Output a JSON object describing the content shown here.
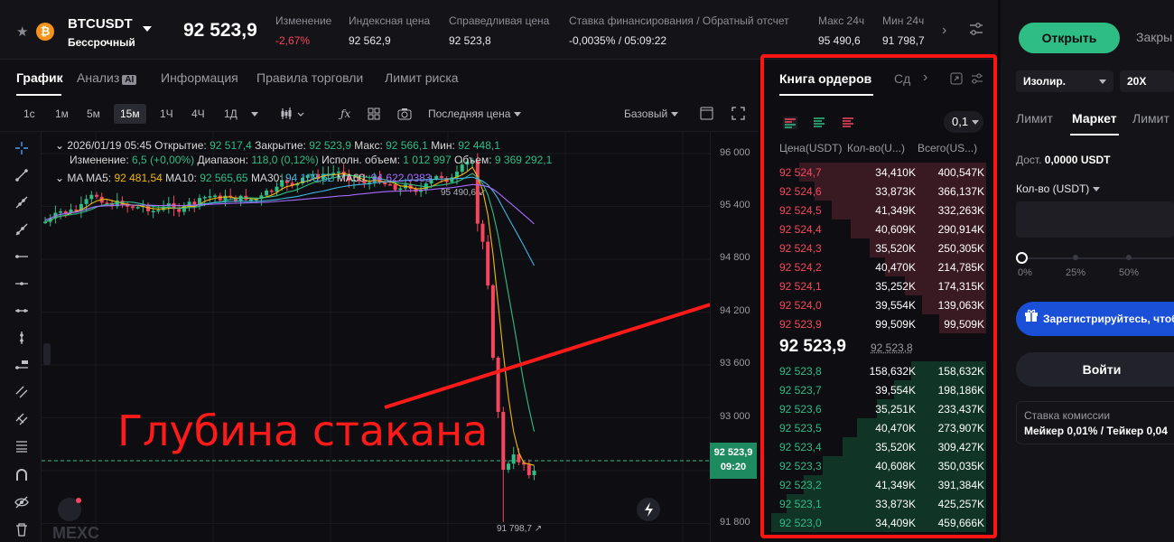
{
  "ticker": {
    "symbol": "BTCUSDT",
    "contract": "Бессрочный",
    "coin_letter": "₿",
    "last_price": "92 523,9",
    "stats": [
      {
        "label": "Изменение",
        "value": "-2,67%",
        "neg": true
      },
      {
        "label": "Индексная цена",
        "value": "92 562,9"
      },
      {
        "label": "Справедливая цена",
        "value": "92 523,8"
      },
      {
        "label": "Ставка финансирования / Обратный отсчет",
        "value": "-0,0035% / 05:09:22"
      },
      {
        "label": "Макс 24ч",
        "value": "95 490,6"
      },
      {
        "label": "Мин 24ч",
        "value": "91 798,7"
      }
    ]
  },
  "tabs": [
    "График",
    "Анализ",
    "Информация",
    "Правила торговли",
    "Лимит риска"
  ],
  "ai_badge": "AI",
  "intervals": [
    "1с",
    "1м",
    "5м",
    "15м",
    "1Ч",
    "4Ч",
    "1Д"
  ],
  "active_interval": "15м",
  "price_type": "Последняя цена",
  "view_mode": "Базовый",
  "overlay": {
    "date": "2026/01/19 05:45",
    "open_l": "Открытие:",
    "open": "92 517,4",
    "close_l": "Закрытие:",
    "close": "92 523,9",
    "max_l": "Макс:",
    "max": "92 566,1",
    "min_l": "Мин:",
    "min": "92 448,1",
    "chg_l": "Изменение:",
    "chg": "6,5 (+0,00%)",
    "rng_l": "Диапазон:",
    "rng": "118,0 (0,12%)",
    "vol_l": "Исполн. объем:",
    "vol": "1 012 997",
    "vol2_l": "Объем:",
    "vol2": "9 369 292,1",
    "ma_l": "MA",
    "ma5_l": "MA5:",
    "ma5": "92 481,54",
    "ma10_l": "MA10:",
    "ma10": "92 565,65",
    "ma30_l": "MA30:",
    "ma30": "94 108,62",
    "ma60_l": "MA60:",
    "ma60": "94 622,0383"
  },
  "y_axis": [
    "96 000",
    "95 400",
    "94 800",
    "94 200",
    "93 600",
    "93 000",
    "91 800"
  ],
  "chart_marks": {
    "high": "95 490,6",
    "low": "91 798,7"
  },
  "price_tag": {
    "price": "92 523,9",
    "timer": "09:20"
  },
  "annotation": "Глубина стакана",
  "watermark": "MEXC",
  "orderbook": {
    "title": "Книга ордеров",
    "tab2": "Сд",
    "step": "0,1",
    "headers": [
      "Цена(USDT)",
      "Кол-во(U...)",
      "Всего(US...)"
    ],
    "asks": [
      {
        "price": "92 524,7",
        "qty": "34,410K",
        "total": "400,547K",
        "depth": 0.87
      },
      {
        "price": "92 524,6",
        "qty": "33,873K",
        "total": "366,137K",
        "depth": 0.8
      },
      {
        "price": "92 524,5",
        "qty": "41,349K",
        "total": "332,263K",
        "depth": 0.72
      },
      {
        "price": "92 524,4",
        "qty": "40,609K",
        "total": "290,914K",
        "depth": 0.63
      },
      {
        "price": "92 524,3",
        "qty": "35,520K",
        "total": "250,305K",
        "depth": 0.54
      },
      {
        "price": "92 524,2",
        "qty": "40,470K",
        "total": "214,785K",
        "depth": 0.47
      },
      {
        "price": "92 524,1",
        "qty": "35,252K",
        "total": "174,315K",
        "depth": 0.38
      },
      {
        "price": "92 524,0",
        "qty": "39,554K",
        "total": "139,063K",
        "depth": 0.3
      },
      {
        "price": "92 523,9",
        "qty": "99,509K",
        "total": "99,509K",
        "depth": 0.22
      }
    ],
    "mid_price": "92 523,9",
    "mark_price": "92 523,8",
    "bids": [
      {
        "price": "92 523,8",
        "qty": "158,632K",
        "total": "158,632K",
        "depth": 0.35
      },
      {
        "price": "92 523,7",
        "qty": "39,554K",
        "total": "198,186K",
        "depth": 0.43
      },
      {
        "price": "92 523,6",
        "qty": "35,251K",
        "total": "233,437K",
        "depth": 0.51
      },
      {
        "price": "92 523,5",
        "qty": "40,470K",
        "total": "273,907K",
        "depth": 0.6
      },
      {
        "price": "92 523,4",
        "qty": "35,520K",
        "total": "309,427K",
        "depth": 0.67
      },
      {
        "price": "92 523,3",
        "qty": "40,608K",
        "total": "350,035K",
        "depth": 0.76
      },
      {
        "price": "92 523,2",
        "qty": "41,349K",
        "total": "391,384K",
        "depth": 0.85
      },
      {
        "price": "92 523,1",
        "qty": "33,873K",
        "total": "425,257K",
        "depth": 0.93
      },
      {
        "price": "92 523,0",
        "qty": "34,409K",
        "total": "459,666K",
        "depth": 1.0
      }
    ]
  },
  "trade": {
    "open": "Открыть",
    "close": "Закры",
    "margin_mode": "Изолир.",
    "leverage": "20X",
    "order_tabs": [
      "Лимит",
      "Маркет",
      "Лимит"
    ],
    "avail_l": "Дост.",
    "avail": "0,0000 USDT",
    "qty_l": "Кол-во (USDT)",
    "pcts": [
      "0%",
      "25%",
      "50%"
    ],
    "promo": "Зарегистрируйтесь, чтоб",
    "login": "Войти",
    "fee_l": "Ставка комиссии",
    "fee": "Мейкер 0,01% / Тейкер 0,04"
  },
  "colors": {
    "up": "#2ebd85",
    "down": "#f6465d",
    "ma5": "#f0b90b",
    "ma10": "#2ebd85",
    "ma30": "#3fb5e0",
    "ma60": "#a66bff",
    "annotation": "#ff1a1a"
  }
}
